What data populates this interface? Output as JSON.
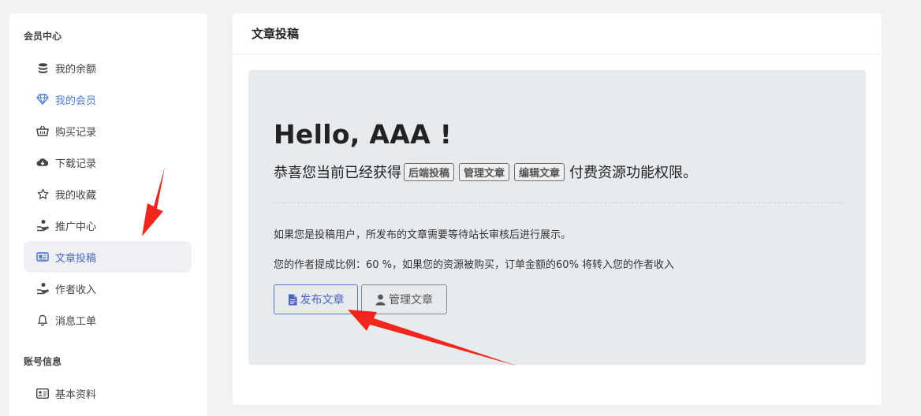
{
  "sidebar": {
    "section1_title": "会员中心",
    "items": [
      {
        "label": "我的余额",
        "icon": "coins-icon"
      },
      {
        "label": "我的会员",
        "icon": "diamond-icon"
      },
      {
        "label": "购买记录",
        "icon": "basket-icon"
      },
      {
        "label": "下载记录",
        "icon": "cloud-download-icon"
      },
      {
        "label": "我的收藏",
        "icon": "star-icon"
      },
      {
        "label": "推广中心",
        "icon": "hand-coin-icon"
      },
      {
        "label": "文章投稿",
        "icon": "newspaper-icon"
      },
      {
        "label": "作者收入",
        "icon": "hand-coin-icon"
      },
      {
        "label": "消息工单",
        "icon": "bell-icon"
      }
    ],
    "section2_title": "账号信息",
    "items2": [
      {
        "label": "基本资料",
        "icon": "id-card-icon"
      }
    ]
  },
  "main": {
    "title": "文章投稿",
    "hello": "Hello, AAA !",
    "congrats_prefix": "恭喜您当前已经获得",
    "tags": [
      "后端投稿",
      "管理文章",
      "编辑文章"
    ],
    "congrats_suffix": "付费资源功能权限。",
    "note1": "如果您是投稿用户，所发布的文章需要等待站长审核后进行展示。",
    "note2": "您的作者提成比例：60 %，如果您的资源被购买，订单金额的60% 将转入您的作者收入",
    "publish_button": "发布文章",
    "manage_button": "管理文章"
  },
  "colors": {
    "accent": "#4a66c9",
    "annotation_arrow": "#f2261c"
  }
}
